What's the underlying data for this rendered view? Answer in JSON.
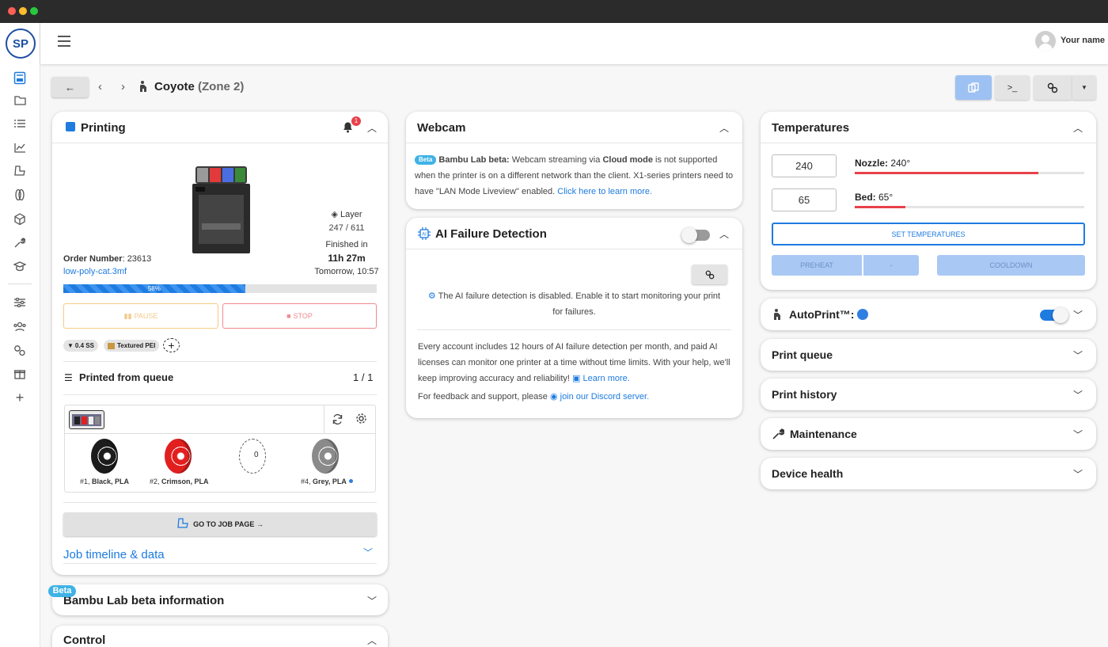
{
  "app": {
    "logo_text": "SP",
    "user_name": "Your name"
  },
  "header": {
    "back_label": "←",
    "printer_name": "Coyote",
    "printer_zone": "(Zone 2)"
  },
  "toolbar": {
    "terminal_label": ">_"
  },
  "printing": {
    "title": "Printing",
    "notification_count": "1",
    "order_label": "Order Number",
    "order_number": ": 23613",
    "file_name": "low-poly-cat.3mf",
    "layer_label": "Layer",
    "layer_value": "247 / 611",
    "finished_label": "Finished in",
    "finished_value": "11h 27m",
    "finished_time": "Tomorrow, 10:57",
    "progress_label": "58%",
    "progress": 0.58,
    "pause_label": "PAUSE",
    "stop_label": "STOP",
    "chips": [
      "0.4 SS",
      "Textured PEI"
    ],
    "queue_title": "Printed from queue",
    "queue_count": "1 / 1",
    "spools": [
      {
        "num": "#1,",
        "name": "Black, PLA",
        "color": "#1c1c1c"
      },
      {
        "num": "#2,",
        "name": "Crimson, PLA",
        "color": "#e21f1f"
      },
      {
        "num": "",
        "name": "",
        "color": "empty",
        "center": "0"
      },
      {
        "num": "#4,",
        "name": "Grey, PLA",
        "color": "#8a8a8a"
      }
    ],
    "job_page_label": "GO TO JOB PAGE →",
    "timeline_label": "Job timeline & data"
  },
  "beta_card": {
    "badge": "Beta",
    "title": "Bambu Lab beta information"
  },
  "control_card": {
    "title": "Control"
  },
  "webcam": {
    "title": "Webcam",
    "badge": "Beta",
    "bold_label": "Bambu Lab beta:",
    "text1": " Webcam streaming via ",
    "cloud_mode": "Cloud mode",
    "text2": " is not supported when the printer is on a different network than the client. X1-series printers need to have \"LAN Mode Liveview\" enabled. ",
    "link": "Click here to learn more."
  },
  "ai": {
    "title": "AI Failure Detection",
    "disabled_text": "The AI failure detection is disabled. Enable it to start monitoring your print for failures.",
    "info_text": "Every account includes 12 hours of AI failure detection per month, and paid AI licenses can monitor one printer at a time without time limits. With your help, we'll keep improving accuracy and reliability!",
    "learn_more": "Learn more.",
    "feedback_text": "For feedback and support, please",
    "discord_link": "join our Discord server",
    "feedback_end": "."
  },
  "temps": {
    "title": "Temperatures",
    "nozzle_input": "240",
    "nozzle_label": "Nozzle:",
    "nozzle_value": " 240°",
    "bed_input": "65",
    "bed_label": "Bed:",
    "bed_value": " 65°",
    "set_label": "SET TEMPERATURES",
    "preheat_label": "PREHEAT",
    "preheat_dash": "-",
    "cooldown_label": "COOLDOWN"
  },
  "sections": {
    "autoprint": "AutoPrint™:",
    "print_queue": "Print queue",
    "print_history": "Print history",
    "maintenance": "Maintenance",
    "device_health": "Device health"
  },
  "colors": {
    "accent": "#1e7be0",
    "danger": "#e8414a",
    "badge": "#3fb2e6"
  }
}
